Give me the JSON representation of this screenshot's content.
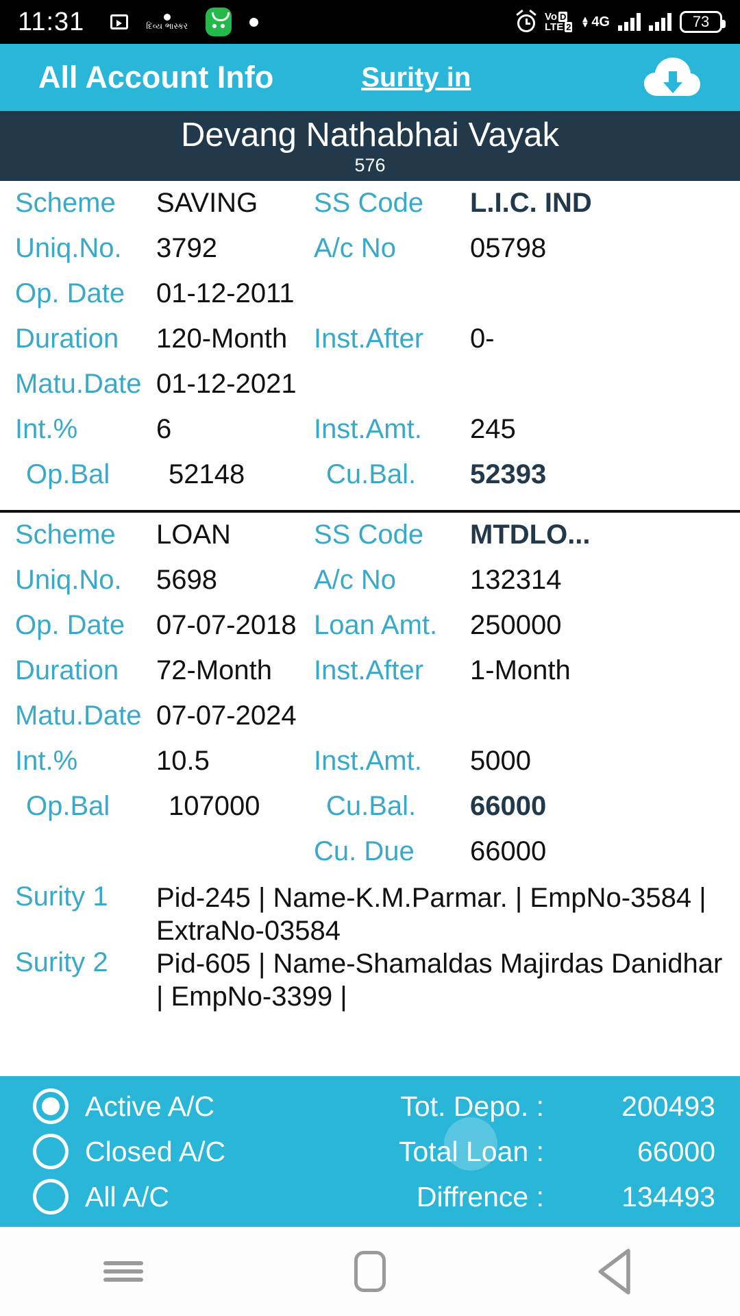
{
  "status_bar": {
    "time": "11:31",
    "icons_left": [
      "video-recorder-icon",
      "gujarati-app-icon",
      "green-app-icon",
      "dot-indicator-icon"
    ],
    "gujarati_label": "દિવ્ય ભાસ્કર",
    "alarm_icon": "alarm-icon",
    "network_label": "VoLTE",
    "sim_index": "2",
    "data_type": "4G",
    "battery_level": "73"
  },
  "app_bar": {
    "title": "All Account Info",
    "link_label": "Surity in",
    "download_icon": "download-cloud-icon"
  },
  "member": {
    "name": "Devang Nathabhai Vayak",
    "code": "576"
  },
  "accounts": [
    {
      "rows": [
        {
          "l1": "Scheme",
          "v1": "SAVING",
          "l2": "SS Code",
          "v2": "L.I.C. IND",
          "v2_bold": true
        },
        {
          "l1": "Uniq.No.",
          "v1": "3792",
          "l2": "A/c No",
          "v2": "05798"
        },
        {
          "l1": "Op. Date",
          "v1": "01-12-2011",
          "l2": "",
          "v2": ""
        },
        {
          "l1": "Duration",
          "v1": "120-Month",
          "l2": "Inst.After",
          "v2": "0-"
        },
        {
          "l1": "Matu.Date",
          "v1": "01-12-2021",
          "l2": "",
          "v2": ""
        },
        {
          "l1": "Int.%",
          "v1": "6",
          "l2": "Inst.Amt.",
          "v2": "245"
        },
        {
          "l1": "Op.Bal",
          "v1": "52148",
          "l2": "Cu.Bal.",
          "v2": "52393",
          "v2_bold": true,
          "indent": true
        }
      ],
      "sureties": []
    },
    {
      "rows": [
        {
          "l1": "Scheme",
          "v1": "LOAN",
          "l2": "SS Code",
          "v2": "MTDLO...",
          "v2_bold": true
        },
        {
          "l1": "Uniq.No.",
          "v1": "5698",
          "l2": "A/c No",
          "v2": "132314"
        },
        {
          "l1": "Op. Date",
          "v1": "07-07-2018",
          "l2": "Loan Amt.",
          "v2": "250000"
        },
        {
          "l1": "Duration",
          "v1": "72-Month",
          "l2": "Inst.After",
          "v2": "1-Month"
        },
        {
          "l1": "Matu.Date",
          "v1": "07-07-2024",
          "l2": "",
          "v2": ""
        },
        {
          "l1": "Int.%",
          "v1": "10.5",
          "l2": "Inst.Amt.",
          "v2": "5000"
        },
        {
          "l1": "Op.Bal",
          "v1": "107000",
          "l2": "Cu.Bal.",
          "v2": "66000",
          "v2_bold": true,
          "indent": true
        },
        {
          "l1": "",
          "v1": "",
          "l2": "Cu. Due",
          "v2": "66000"
        }
      ],
      "sureties": [
        {
          "label": "Surity 1",
          "value": "Pid-245 | Name-K.M.Parmar. | EmpNo-3584 | ExtraNo-03584"
        },
        {
          "label": "Surity 2",
          "value": "Pid-605 | Name-Shamaldas Majirdas Danidhar | EmpNo-3399 |"
        }
      ]
    }
  ],
  "filter": {
    "options": [
      {
        "label": "Active A/C",
        "selected": true
      },
      {
        "label": "Closed A/C",
        "selected": false
      },
      {
        "label": "All A/C",
        "selected": false
      }
    ]
  },
  "totals": [
    {
      "label": "Tot. Depo. :",
      "value": "200493"
    },
    {
      "label": "Total Loan :",
      "value": "66000"
    },
    {
      "label": "Diffrence :",
      "value": "134493"
    }
  ],
  "nav_bar": {
    "menu": "menu-icon",
    "home": "home-icon",
    "back": "back-icon"
  }
}
